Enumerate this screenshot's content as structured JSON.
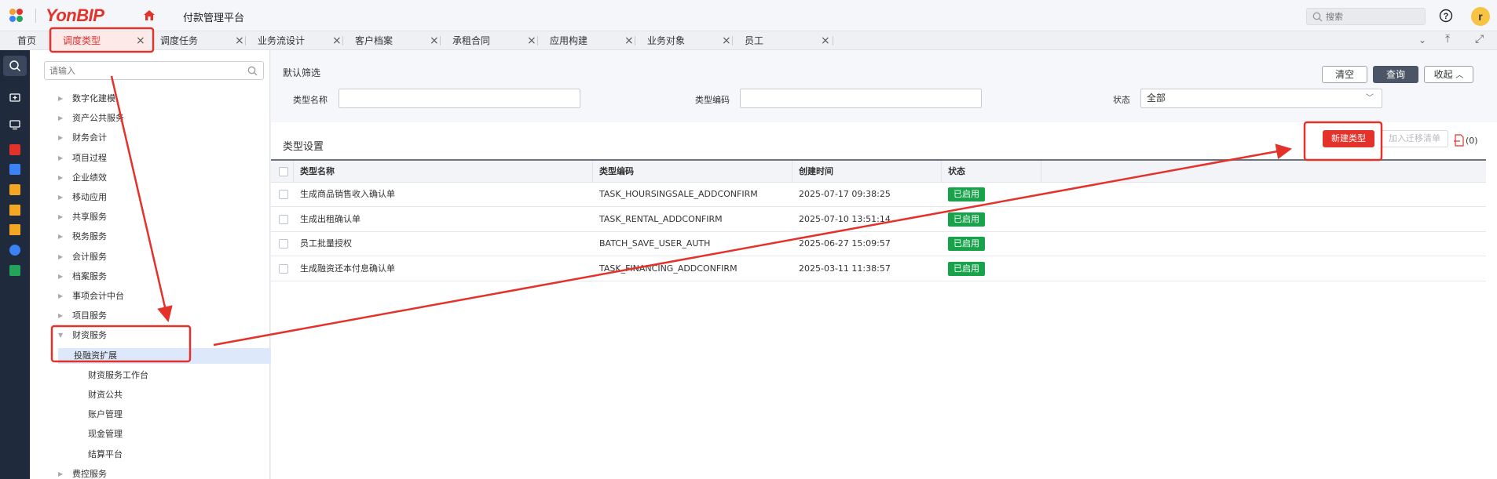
{
  "header": {
    "brand": "YonBIP",
    "app_title": "付款管理平台",
    "search_placeholder": "搜索",
    "avatar_initial": "r"
  },
  "tabs": [
    {
      "label": "首页",
      "closable": false,
      "active": false
    },
    {
      "label": "调度类型",
      "closable": true,
      "active": true
    },
    {
      "label": "调度任务",
      "closable": true,
      "active": false
    },
    {
      "label": "业务流设计",
      "closable": true,
      "active": false
    },
    {
      "label": "客户档案",
      "closable": true,
      "active": false
    },
    {
      "label": "承租合同",
      "closable": true,
      "active": false
    },
    {
      "label": "应用构建",
      "closable": true,
      "active": false
    },
    {
      "label": "业务对象",
      "closable": true,
      "active": false
    },
    {
      "label": "员工",
      "closable": true,
      "active": false
    }
  ],
  "rail_icons": [
    "search-icon",
    "folder-add-icon",
    "monitor-icon",
    "red-app-icon",
    "blue-app-icon",
    "yellow-app-icon",
    "cart-icon",
    "cart-icon",
    "cloud-icon",
    "green-app-icon"
  ],
  "tree": {
    "search_placeholder": "请输入",
    "items": [
      {
        "label": "数字化建模",
        "level": 1,
        "caret": "▶"
      },
      {
        "label": "资产公共服务",
        "level": 1,
        "caret": "▶"
      },
      {
        "label": "财务会计",
        "level": 1,
        "caret": "▶"
      },
      {
        "label": "项目过程",
        "level": 1,
        "caret": "▶"
      },
      {
        "label": "企业绩效",
        "level": 1,
        "caret": "▶"
      },
      {
        "label": "移动应用",
        "level": 1,
        "caret": "▶"
      },
      {
        "label": "共享服务",
        "level": 1,
        "caret": "▶"
      },
      {
        "label": "税务服务",
        "level": 1,
        "caret": "▶"
      },
      {
        "label": "会计服务",
        "level": 1,
        "caret": "▶"
      },
      {
        "label": "档案服务",
        "level": 1,
        "caret": "▶"
      },
      {
        "label": "事项会计中台",
        "level": 1,
        "caret": "▶"
      },
      {
        "label": "项目服务",
        "level": 1,
        "caret": "▶"
      },
      {
        "label": "财资服务",
        "level": 1,
        "caret": "▼"
      },
      {
        "label": "投融资扩展",
        "level": 2,
        "caret": "",
        "selected": true
      },
      {
        "label": "财资服务工作台",
        "level": 2,
        "caret": ""
      },
      {
        "label": "财资公共",
        "level": 2,
        "caret": ""
      },
      {
        "label": "账户管理",
        "level": 2,
        "caret": ""
      },
      {
        "label": "现金管理",
        "level": 2,
        "caret": ""
      },
      {
        "label": "结算平台",
        "level": 2,
        "caret": ""
      },
      {
        "label": "费控服务",
        "level": 1,
        "caret": "▶"
      }
    ]
  },
  "filter": {
    "title": "默认筛选",
    "clear_label": "清空",
    "query_label": "查询",
    "collapse_label": "收起",
    "type_name_label": "类型名称",
    "type_name_value": "",
    "type_code_label": "类型编码",
    "type_code_value": "",
    "status_label": "状态",
    "status_value": "全部"
  },
  "section": {
    "title": "类型设置",
    "new_type_label": "新建类型",
    "add_migration_label": "加入迁移清单",
    "export_count": "(0)"
  },
  "table": {
    "columns": [
      "类型名称",
      "类型编码",
      "创建时间",
      "状态"
    ],
    "rows": [
      {
        "name": "生成商品销售收入确认单",
        "code": "TASK_HOURSINGSALE_ADDCONFIRM",
        "created": "2025-07-17 09:38:25",
        "status": "已启用"
      },
      {
        "name": "生成出租确认单",
        "code": "TASK_RENTAL_ADDCONFIRM",
        "created": "2025-07-10 13:51:14",
        "status": "已启用"
      },
      {
        "name": "员工批量授权",
        "code": "BATCH_SAVE_USER_AUTH",
        "created": "2025-06-27 15:09:57",
        "status": "已启用"
      },
      {
        "name": "生成融资还本付息确认单",
        "code": "TASK_FINANCING_ADDCONFIRM",
        "created": "2025-03-11 11:38:57",
        "status": "已启用"
      }
    ]
  },
  "colors": {
    "brand_red": "#e4322b",
    "status_green": "#17a34a",
    "rail_bg": "#1f2a3d",
    "selected_bg": "#dde8fb"
  }
}
